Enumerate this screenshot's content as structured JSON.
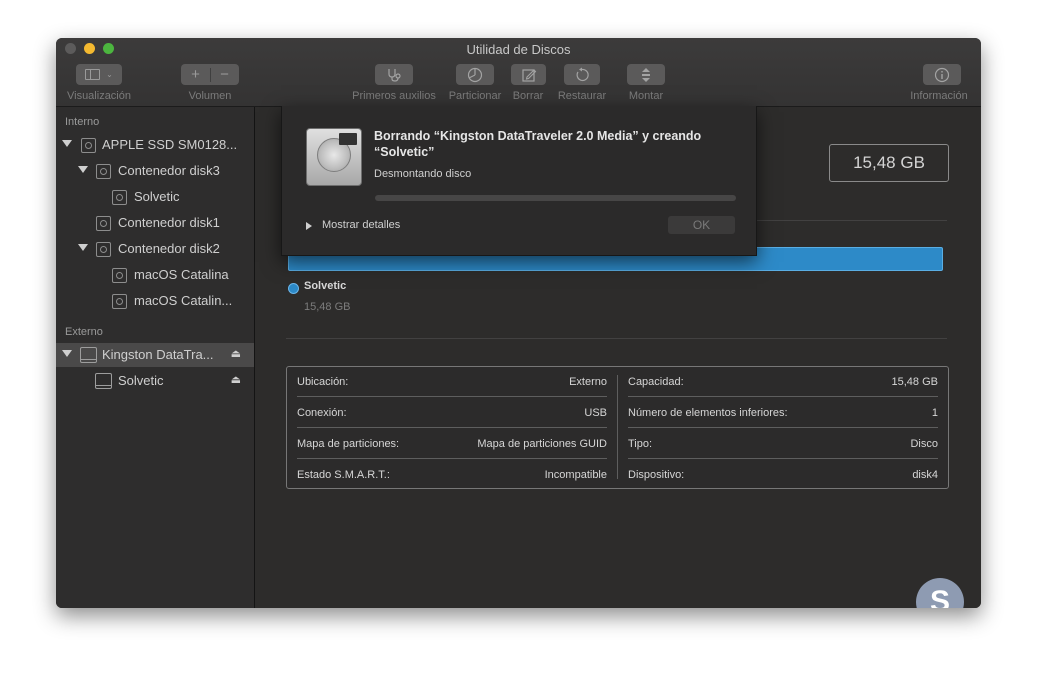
{
  "window": {
    "title": "Utilidad de Discos"
  },
  "toolbar": {
    "view_label": "Visualización",
    "volume_label": "Volumen",
    "first_aid_label": "Primeros auxilios",
    "partition_label": "Particionar",
    "erase_label": "Borrar",
    "restore_label": "Restaurar",
    "mount_label": "Montar",
    "info_label": "Información",
    "add_glyph": "+",
    "remove_glyph": "−"
  },
  "sidebar": {
    "internal_header": "Interno",
    "external_header": "Externo",
    "internal_items": [
      "APPLE SSD SM0128...",
      "Contenedor disk3",
      "Solvetic",
      "Contenedor disk1",
      "Contenedor disk2",
      "macOS Catalina",
      "macOS Catalin..."
    ],
    "external_items": [
      "Kingston DataTra...",
      "Solvetic"
    ],
    "eject_glyph": "⏏"
  },
  "main": {
    "capacity": "15,48 GB",
    "legend": {
      "name": "Solvetic",
      "size": "15,48 GB",
      "color": "#2d8ac8"
    },
    "info": {
      "ubicacion": {
        "label": "Ubicación:",
        "value": "Externo"
      },
      "capacidad": {
        "label": "Capacidad:",
        "value": "15,48 GB"
      },
      "conexion": {
        "label": "Conexión:",
        "value": "USB"
      },
      "elementos": {
        "label": "Número de elementos inferiores:",
        "value": "1"
      },
      "mapa": {
        "label": "Mapa de particiones:",
        "value": "Mapa de particiones GUID"
      },
      "tipo": {
        "label": "Tipo:",
        "value": "Disco"
      },
      "smart": {
        "label": "Estado S.M.A.R.T.:",
        "value": "Incompatible"
      },
      "dispositivo": {
        "label": "Dispositivo:",
        "value": "disk4"
      }
    }
  },
  "sheet": {
    "title": "Borrando “Kingston DataTraveler 2.0 Media” y creando “Solvetic”",
    "status": "Desmontando disco",
    "details": "Mostrar detalles",
    "ok": "OK"
  },
  "watermark": {
    "glyph": "S"
  }
}
